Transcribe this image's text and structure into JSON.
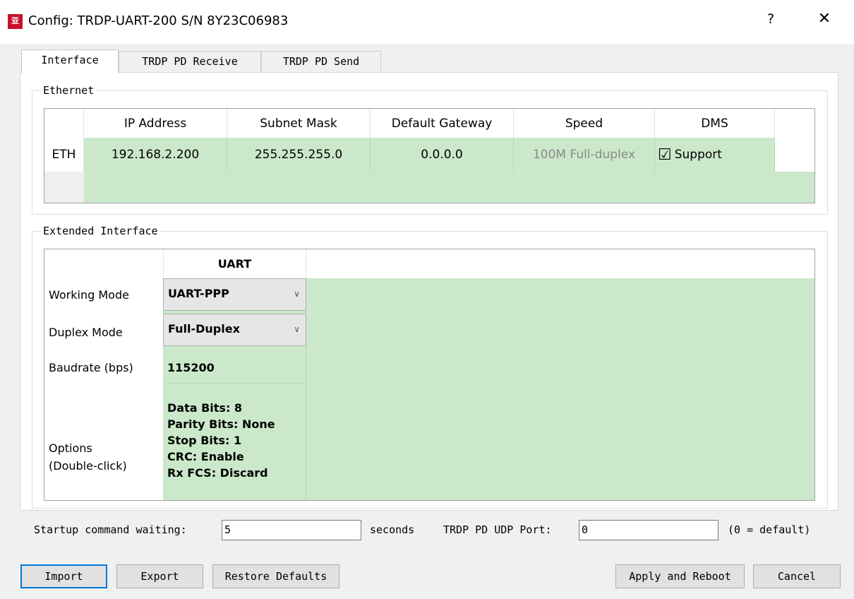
{
  "window": {
    "logo": "亚",
    "title": "Config: TRDP-UART-200  S/N 8Y23C06983",
    "help": "?",
    "close": "✕"
  },
  "tabs": [
    "Interface",
    "TRDP PD Receive",
    "TRDP PD Send"
  ],
  "ethernet": {
    "group_title": "Ethernet",
    "headers": [
      "IP Address",
      "Subnet Mask",
      "Default Gateway",
      "Speed",
      "DMS"
    ],
    "row_label": "ETH",
    "ip": "192.168.2.200",
    "subnet": "255.255.255.0",
    "gateway": "0.0.0.0",
    "speed": "100M Full-duplex",
    "dms_checkbox": "☑",
    "dms_label": "Support"
  },
  "extended": {
    "group_title": "Extended Interface",
    "column_header": "UART",
    "rows": {
      "working_mode_label": "Working Mode",
      "working_mode_value": "UART-PPP",
      "duplex_mode_label": "Duplex Mode",
      "duplex_mode_value": "Full-Duplex",
      "baudrate_label": "Baudrate (bps)",
      "baudrate_value": "115200",
      "options_label_1": "Options",
      "options_label_2": "(Double-click)",
      "options_values": [
        "Data Bits: 8",
        "Parity Bits: None",
        "Stop Bits: 1",
        "CRC: Enable",
        "Rx FCS: Discard"
      ]
    },
    "scroll_up": "^",
    "scroll_down": "v"
  },
  "bottom": {
    "startup_label": "Startup command waiting:",
    "startup_value": "5",
    "seconds_label": "seconds",
    "udp_label": "TRDP PD UDP Port:",
    "udp_value": "0",
    "udp_hint": "(0 = default)"
  },
  "buttons": {
    "import": "Import",
    "export": "Export",
    "restore": "Restore Defaults",
    "apply": "Apply and Reboot",
    "cancel": "Cancel"
  }
}
